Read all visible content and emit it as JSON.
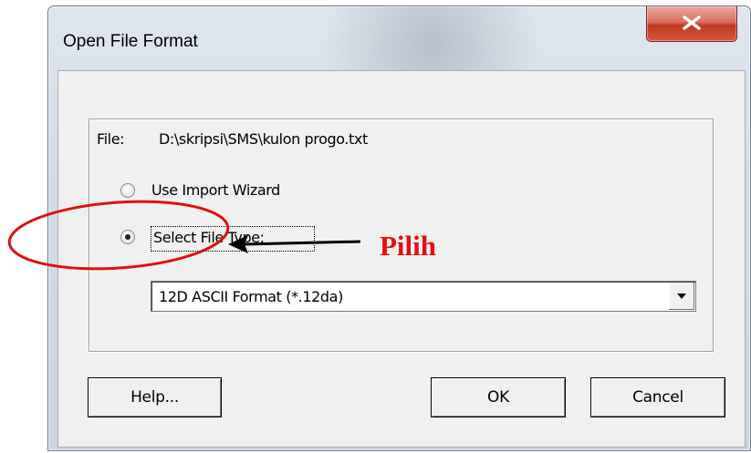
{
  "window": {
    "title": "Open File Format"
  },
  "dialog": {
    "file_label": "File:",
    "file_path": "D:\\skripsi\\SMS\\kulon progo.txt",
    "options": [
      {
        "label": "Use Import Wizard",
        "checked": false
      },
      {
        "label": "Select File Type:",
        "checked": true
      }
    ],
    "file_type_select": {
      "selected": "12D ASCII Format (*.12da)"
    },
    "buttons": {
      "help": "Help...",
      "ok": "OK",
      "cancel": "Cancel"
    }
  },
  "annotation": {
    "label": "Pilih",
    "color": "#e0100e"
  },
  "icons": {
    "close": "close-icon",
    "dropdown": "chevron-down-icon"
  }
}
